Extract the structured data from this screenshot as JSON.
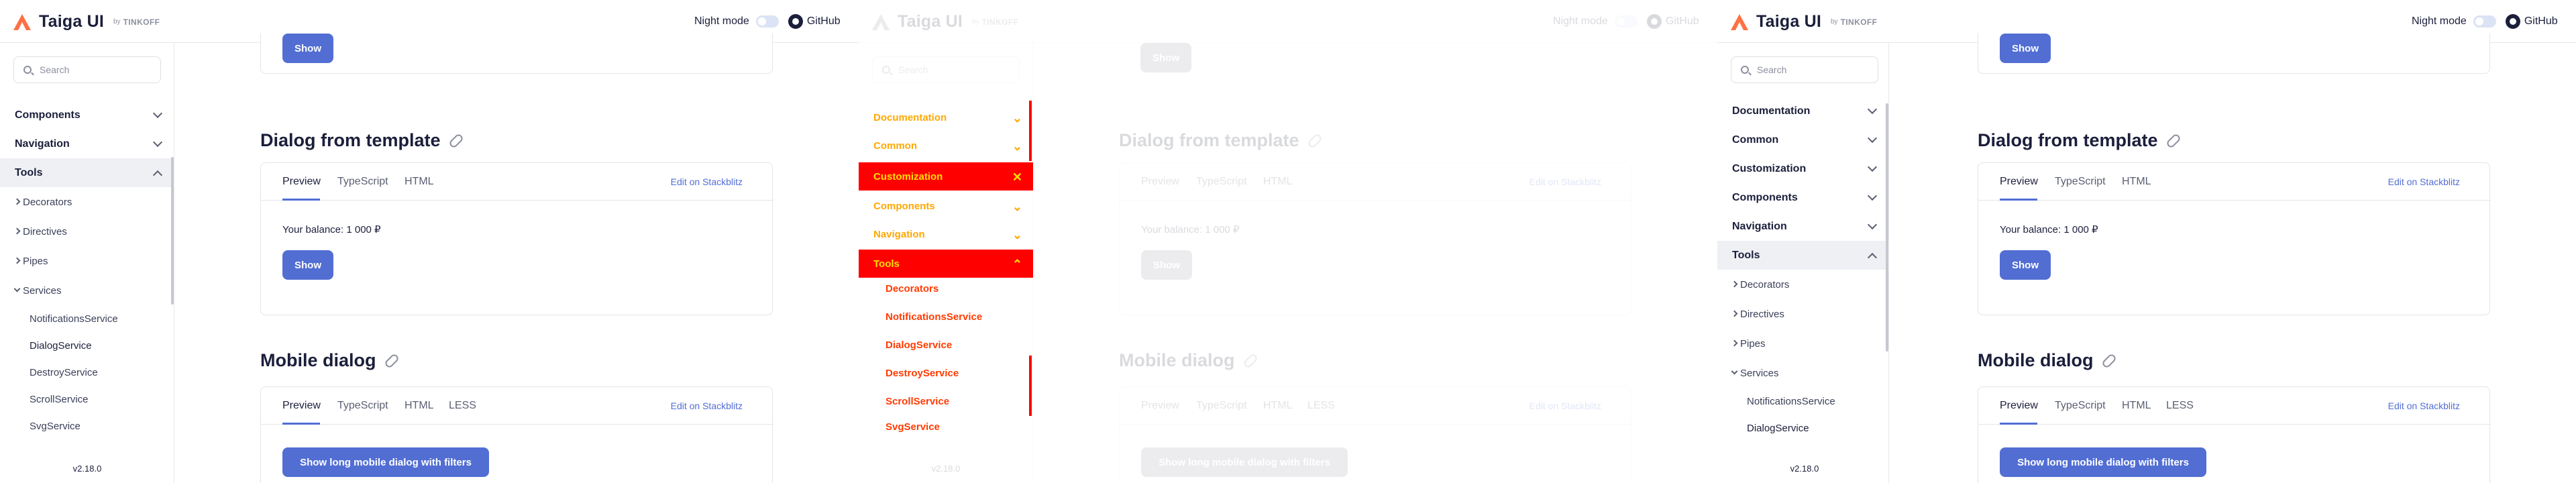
{
  "brand": {
    "title": "Taiga UI",
    "by": "by",
    "company": "TINKOFF"
  },
  "header": {
    "night_mode": "Night mode",
    "github": "GitHub"
  },
  "search": {
    "placeholder": "Search"
  },
  "sidebar_a": {
    "sections": [
      "Components",
      "Navigation",
      "Tools"
    ],
    "subs": [
      "Decorators",
      "Directives",
      "Pipes",
      "Services"
    ],
    "leaves": [
      "NotificationsService",
      "DialogService",
      "DestroyService",
      "ScrollService",
      "SvgService"
    ]
  },
  "sidebar_c": {
    "sections": [
      "Documentation",
      "Common",
      "Customization",
      "Components",
      "Navigation",
      "Tools"
    ],
    "subs": [
      "Decorators",
      "Directives",
      "Pipes",
      "Services"
    ],
    "leaves": [
      "NotificationsService",
      "DialogService"
    ]
  },
  "overlay_menu": {
    "rows": [
      "Documentation",
      "Common",
      "Customization",
      "Components",
      "Navigation",
      "Tools"
    ],
    "leaves": [
      "Decorators",
      "NotificationsService",
      "DialogService",
      "DestroyService",
      "ScrollService",
      "SvgService"
    ]
  },
  "version": "v2.18.0",
  "main": {
    "show_label": "Show",
    "section1_title": "Dialog from template",
    "section2_title": "Mobile dialog",
    "tabs1": [
      "Preview",
      "TypeScript",
      "HTML"
    ],
    "tabs2": [
      "Preview",
      "TypeScript",
      "HTML",
      "LESS"
    ],
    "stackblitz": "Edit on Stackblitz",
    "balance": "Your balance: 1 000 ₽",
    "mobile_button": "Show long mobile dialog with filters"
  },
  "colors": {
    "accent": "#526ed3",
    "brand_logo": "#ff7043",
    "overlay_red": "#ff0000",
    "overlay_yellow": "#ffe100"
  }
}
